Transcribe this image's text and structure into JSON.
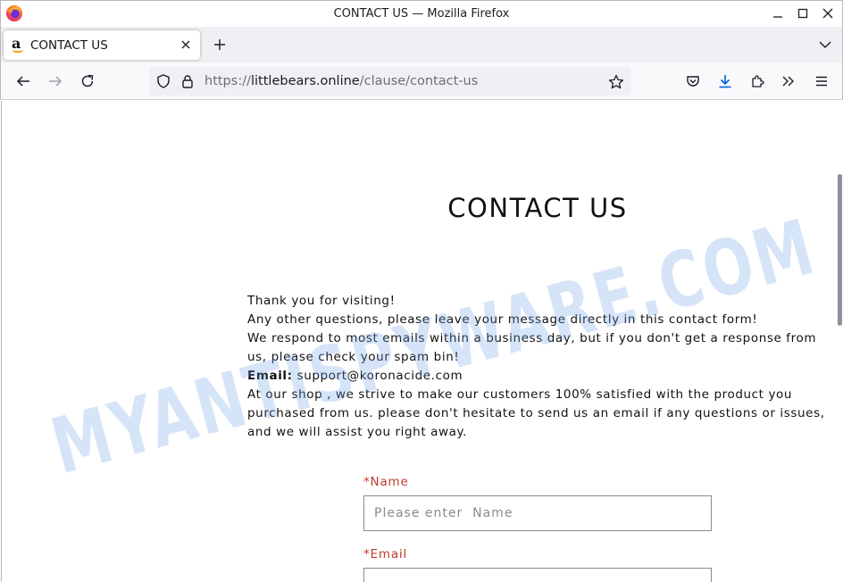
{
  "window": {
    "title": "CONTACT US — Mozilla Firefox",
    "controls": [
      "minimize-icon",
      "maximize-icon",
      "close-icon"
    ]
  },
  "tabs": [
    {
      "label": "CONTACT US",
      "favicon": "amazon-a-icon",
      "active": true
    }
  ],
  "toolbar": {
    "url": {
      "scheme": "https://",
      "host": "littlebears.online",
      "path": "/clause/contact-us"
    },
    "icons": [
      "back-icon",
      "forward-icon",
      "reload-icon",
      "shield-icon",
      "lock-icon",
      "bookmark-star-icon",
      "pocket-icon",
      "downloads-icon",
      "extensions-icon",
      "overflow-chevrons-icon",
      "menu-icon"
    ],
    "download_accent": "#0060df"
  },
  "page": {
    "title": "CONTACT US",
    "lines": [
      "Thank you for visiting!",
      "Any other questions, please leave your message directly in this contact form!",
      "We respond to most emails within a business day, but if you don't get a response from",
      "us, please check your spam bin!"
    ],
    "email_label": "Email:",
    "email_value": "support@koronacide.com",
    "lines_after": [
      "At our shop , we strive to make our customers 100% satisfied with the product you",
      "purchased from us. please don't hesitate to send us an email if any questions or issues,",
      "and we will assist you right away."
    ],
    "form": {
      "name_label": "*Name",
      "name_placeholder": "Please enter  Name",
      "email_label": "*Email"
    },
    "required_color": "#c0392b"
  },
  "watermark": {
    "text": "MYANTISPYWARE.COM",
    "color": "#6b9fe6"
  }
}
